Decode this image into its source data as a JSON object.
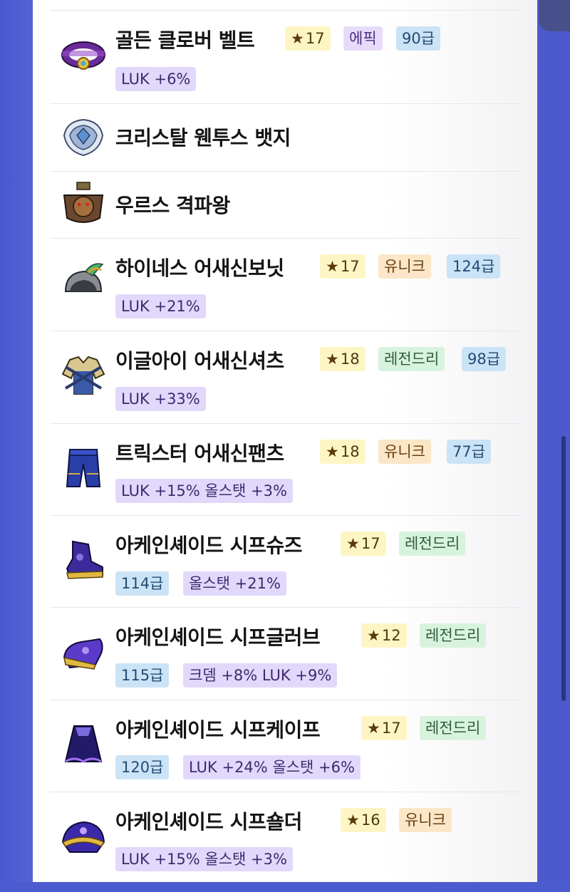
{
  "items": [
    {
      "name": "골든 클로버 벨트",
      "star": "17",
      "grade": "에픽",
      "level": "90급",
      "options": "LUK +6%",
      "icon": "belt-icon"
    },
    {
      "name": "크리스탈 웬투스 뱃지",
      "icon": "badge-icon"
    },
    {
      "name": "우르스 격파왕",
      "icon": "medal-icon"
    },
    {
      "name": "하이네스 어새신보닛",
      "star": "17",
      "grade": "유니크",
      "level": "124급",
      "options": "LUK +21%",
      "icon": "helmet-icon"
    },
    {
      "name": "이글아이 어새신셔츠",
      "star": "18",
      "grade": "레전드리",
      "level": "98급",
      "options": "LUK +33%",
      "icon": "shirt-icon"
    },
    {
      "name": "트릭스터 어새신팬츠",
      "star": "18",
      "grade": "유니크",
      "level": "77급",
      "options": "LUK +15% 올스탯 +3%",
      "icon": "pants-icon"
    },
    {
      "name": "아케인셰이드 시프슈즈",
      "star": "17",
      "grade": "레전드리",
      "level": "114급",
      "options": "올스탯 +21%",
      "icon": "shoes-icon"
    },
    {
      "name": "아케인셰이드 시프글러브",
      "star": "12",
      "grade": "레전드리",
      "level": "115급",
      "options": "크뎀 +8% LUK +9%",
      "icon": "glove-icon"
    },
    {
      "name": "아케인셰이드 시프케이프",
      "star": "17",
      "grade": "레전드리",
      "level": "120급",
      "options": "LUK +24% 올스탯 +6%",
      "icon": "cape-icon"
    },
    {
      "name": "아케인셰이드 시프숄더",
      "star": "16",
      "grade": "유니크",
      "options": "LUK +15% 올스탯 +3%",
      "icon": "shoulder-icon"
    }
  ],
  "colors": {
    "background": "#4d5bd0",
    "epic": "#e6dcfa",
    "unique": "#fbe6c8",
    "legendary": "#d8f3dd",
    "level": "#cbe3f6",
    "star": "#fdf6c4"
  }
}
